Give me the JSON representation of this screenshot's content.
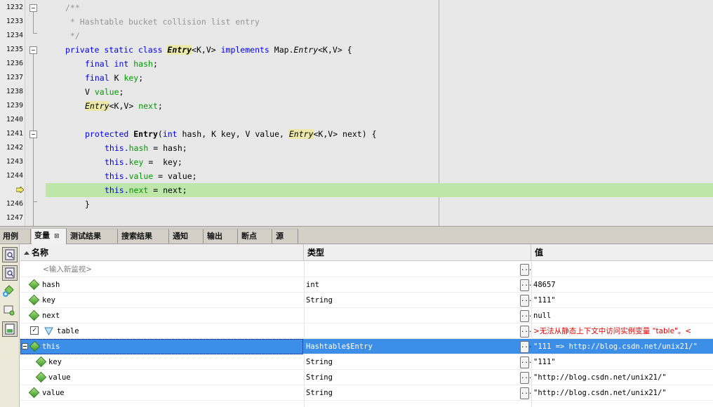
{
  "editor": {
    "line_numbers": [
      "1232",
      "1233",
      "1234",
      "1235",
      "1236",
      "1237",
      "1238",
      "1239",
      "1240",
      "1241",
      "1242",
      "1243",
      "1244",
      "",
      "1246",
      "1247"
    ],
    "lines": {
      "l1232": "/**",
      "l1233": " * Hashtable bucket collision list entry",
      "l1234": " */",
      "l1235_kw": "private static class",
      "l1235_name": "Entry",
      "l1235_generic": "<K,V>",
      "l1235_impl": "implements",
      "l1235_map": "Map.",
      "l1235_entry": "Entry",
      "l1235_rest": "<K,V> {",
      "l1236_kw": "final int",
      "l1236_fld": "hash",
      "l1236_end": ";",
      "l1237_kw": "final",
      "l1237_type": "K",
      "l1237_fld": "key",
      "l1237_end": ";",
      "l1238_type": "V",
      "l1238_fld": "value",
      "l1238_end": ";",
      "l1239_type": "Entry",
      "l1239_generic": "<K,V>",
      "l1239_fld": "next",
      "l1239_end": ";",
      "l1241_kw": "protected",
      "l1241_name": "Entry",
      "l1241_a": "(",
      "l1241_int": "int",
      "l1241_b": "hash, K key, V value,",
      "l1241_entry": "Entry",
      "l1241_c": "<K,V> next) {",
      "l1242_this": "this.",
      "l1242_fld": "hash",
      "l1242_rest": " = hash;",
      "l1243_this": "this.",
      "l1243_fld": "key",
      "l1243_rest": " =  key;",
      "l1244_this": "this.",
      "l1244_fld": "value",
      "l1244_rest": " = value;",
      "l1245_this": "this.",
      "l1245_fld": "next",
      "l1245_rest": " = next;",
      "l1246": "}"
    }
  },
  "tabs": [
    {
      "label": "用例"
    },
    {
      "label": "变量",
      "close": "⊠",
      "active": true
    },
    {
      "label": "测试结果"
    },
    {
      "label": "搜索结果"
    },
    {
      "label": "通知"
    },
    {
      "label": "输出"
    },
    {
      "label": "断点"
    },
    {
      "label": "源"
    }
  ],
  "variables": {
    "columns": {
      "name": "名称",
      "type": "类型",
      "value": "值"
    },
    "button_label": "...",
    "rows": [
      {
        "name": "<输入新监视>",
        "type": "",
        "value": ""
      },
      {
        "name": "hash",
        "type": "int",
        "value": "48657"
      },
      {
        "name": "key",
        "type": "String",
        "value": "\"111\""
      },
      {
        "name": "next",
        "type": "",
        "value": "null"
      },
      {
        "name": "table",
        "type": "",
        "value": ">无法从静态上下文中访问实例变量 \"table\"。<",
        "checked": "✓"
      },
      {
        "name": "this",
        "type": "Hashtable$Entry",
        "value": "\"111 => http://blog.csdn.net/unix21/\""
      },
      {
        "name": "key",
        "type": "String",
        "value": "\"111\""
      },
      {
        "name": "value",
        "type": "String",
        "value": "\"http://blog.csdn.net/unix21/\""
      },
      {
        "name": "value",
        "type": "String",
        "value": "\"http://blog.csdn.net/unix21/\""
      }
    ]
  },
  "colors": {
    "current_line": "#bde6a8",
    "selection": "#3d8ee6",
    "error_text": "#e00000"
  },
  "icons": [
    "fold-toggle-icon",
    "execution-arrow-icon",
    "variable-diamond-icon",
    "field-icon",
    "sidebar-toolbar-icons"
  ]
}
